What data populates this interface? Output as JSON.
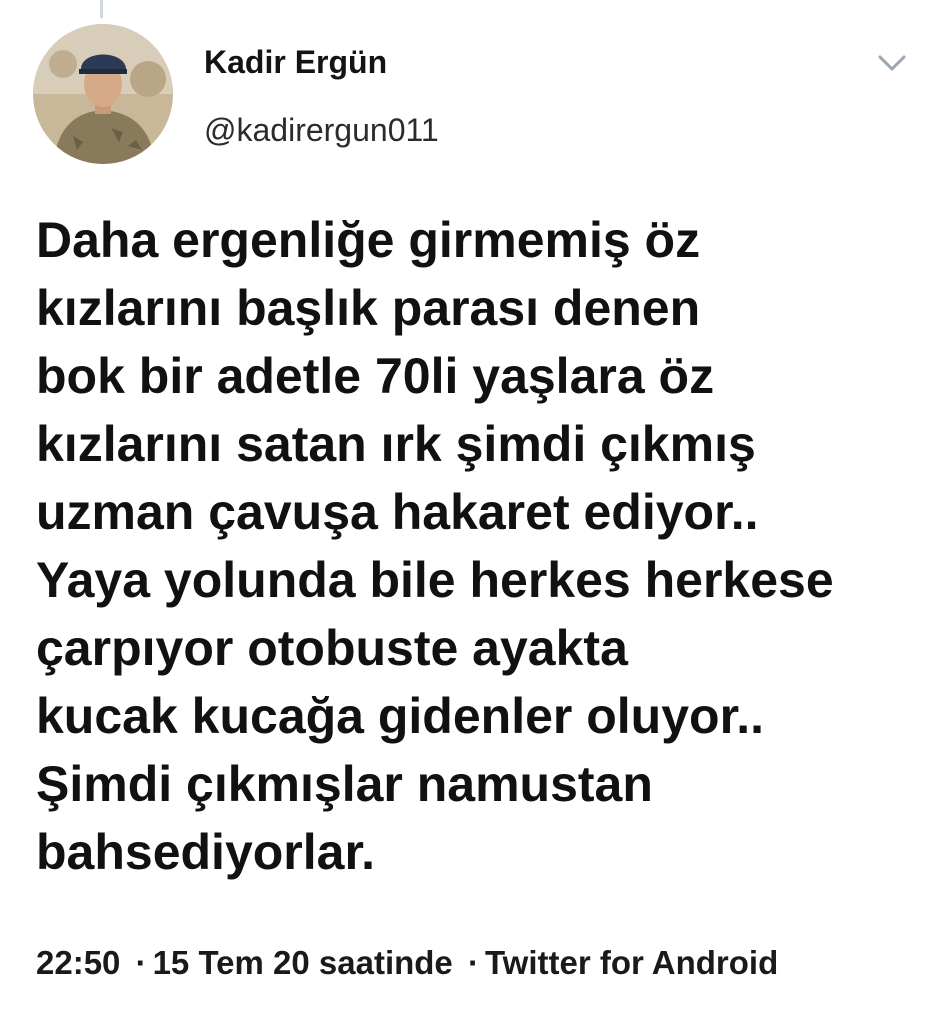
{
  "author": {
    "display_name": "Kadir Ergün",
    "handle": "@kadirergun011"
  },
  "icons": {
    "menu": "chevron-down-icon"
  },
  "tweet": {
    "lines": [
      "Daha ergenliğe girmemiş öz",
      "kızlarını başlık parası denen",
      "bok bir adetle 70li yaşlara öz",
      "kızlarını satan ırk şimdi çıkmış",
      "uzman çavuşa hakaret ediyor..",
      "Yaya yolunda bile herkes herkese",
      "çarpıyor otobuste ayakta",
      "kucak kucağa gidenler oluyor..",
      "Şimdi çıkmışlar namustan",
      "bahsediyorlar."
    ]
  },
  "meta": {
    "time": "22:50",
    "separator": "·",
    "date": "15 Tem 20 saatinde",
    "source": "Twitter for Android"
  },
  "colors": {
    "background": "#ffffff",
    "text": "#111111",
    "chevron": "#9aa5b1"
  }
}
